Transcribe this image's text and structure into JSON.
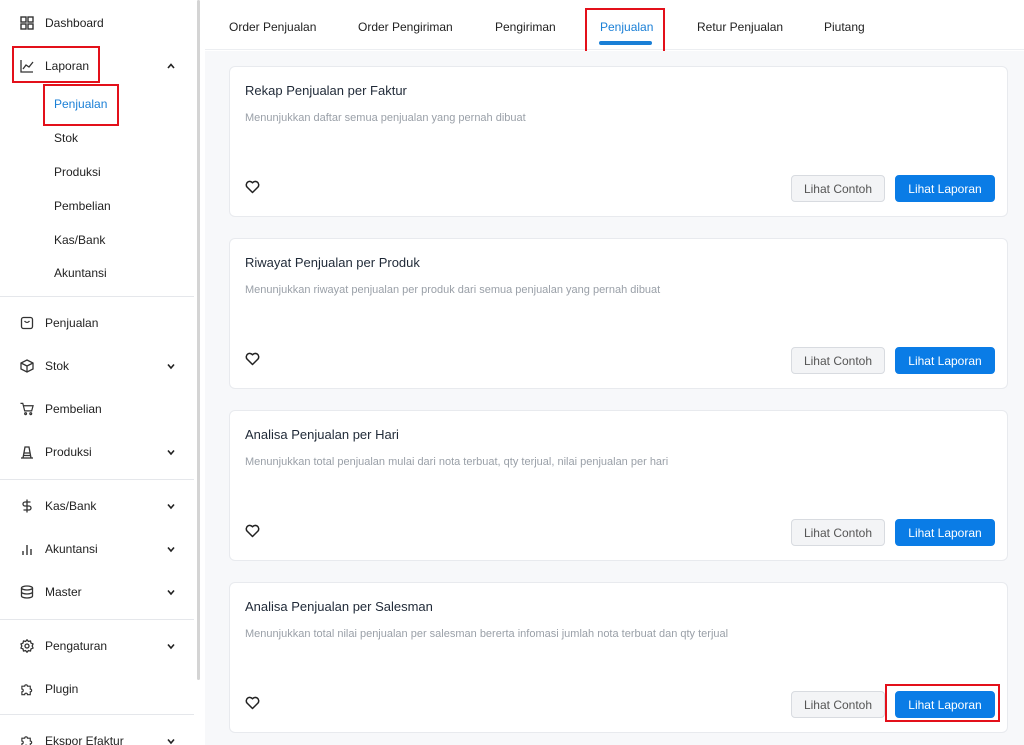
{
  "sidebar": {
    "items": [
      {
        "label": "Dashboard",
        "icon": "grid-icon"
      },
      {
        "label": "Laporan",
        "icon": "chart-line-icon"
      },
      {
        "label": "Penjualan",
        "icon": "receipt-icon"
      },
      {
        "label": "Stok",
        "icon": "box-icon"
      },
      {
        "label": "Pembelian",
        "icon": "cart-icon"
      },
      {
        "label": "Produksi",
        "icon": "factory-icon"
      },
      {
        "label": "Kas/Bank",
        "icon": "dollar-icon"
      },
      {
        "label": "Akuntansi",
        "icon": "bar-chart-icon"
      },
      {
        "label": "Master",
        "icon": "database-icon"
      },
      {
        "label": "Pengaturan",
        "icon": "gear-icon"
      },
      {
        "label": "Plugin",
        "icon": "plugin-icon"
      },
      {
        "label": "Ekspor Efaktur",
        "icon": "export-icon"
      }
    ],
    "laporan_sub": [
      "Penjualan",
      "Stok",
      "Produksi",
      "Pembelian",
      "Kas/Bank",
      "Akuntansi"
    ]
  },
  "tabs": [
    "Order Penjualan",
    "Order Pengiriman",
    "Pengiriman",
    "Penjualan",
    "Retur Penjualan",
    "Piutang"
  ],
  "active_tab": "Penjualan",
  "cards": [
    {
      "title": "Rekap Penjualan per Faktur",
      "desc": "Menunjukkan daftar semua penjualan yang pernah dibuat"
    },
    {
      "title": "Riwayat Penjualan per Produk",
      "desc": "Menunjukkan riwayat penjualan per produk dari semua penjualan yang pernah dibuat"
    },
    {
      "title": "Analisa Penjualan per Hari",
      "desc": "Menunjukkan total penjualan mulai dari nota terbuat, qty terjual, nilai penjualan per hari"
    },
    {
      "title": "Analisa Penjualan per Salesman",
      "desc": "Menunjukkan total nilai penjualan per salesman bererta infomasi jumlah nota terbuat dan qty terjual"
    }
  ],
  "buttons": {
    "example": "Lihat Contoh",
    "view": "Lihat Laporan"
  },
  "colors": {
    "accent": "#1a7fd6",
    "primary_button": "#0a7ce6",
    "highlight": "#e3101a"
  }
}
